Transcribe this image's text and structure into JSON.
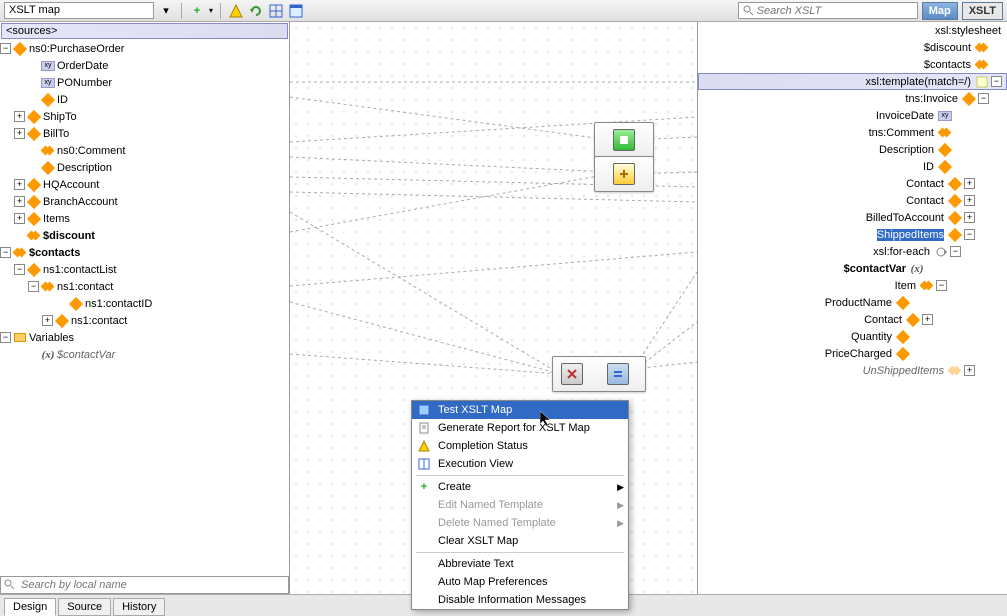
{
  "toolbar": {
    "title": "XSLT map",
    "search_placeholder": "Search XSLT",
    "map_btn": "Map",
    "xslt_btn": "XSLT"
  },
  "filter": {
    "placeholder": "Search by local name"
  },
  "bottom_tabs": {
    "t0": "Design",
    "t1": "Source",
    "t2": "History"
  },
  "source_tree": {
    "header": "<sources>",
    "n0": "ns0:PurchaseOrder",
    "n1": "OrderDate",
    "n2": "PONumber",
    "n3": "ID",
    "n4": "ShipTo",
    "n5": "BillTo",
    "n6": "ns0:Comment",
    "n7": "Description",
    "n8": "HQAccount",
    "n9": "BranchAccount",
    "n10": "Items",
    "n11": "$discount",
    "n12": "$contacts",
    "n13": "ns1:contactList",
    "n14": "ns1:contact",
    "n15": "ns1:contactID",
    "n16": "ns1:contact",
    "n17": "Variables",
    "n18": "$contactVar"
  },
  "target_tree": {
    "n0": "xsl:stylesheet",
    "n1": "$discount",
    "n2": "$contacts",
    "n3": "xsl:template(match=/)",
    "n4": "tns:Invoice",
    "n5": "InvoiceDate",
    "n6": "tns:Comment",
    "n7": "Description",
    "n8": "ID",
    "n9": "Contact",
    "n10": "Contact",
    "n11": "BilledToAccount",
    "n12": "ShippedItems",
    "n13": "xsl:for-each",
    "n14": "$contactVar",
    "n15": "Item",
    "n16": "ProductName",
    "n17": "Contact",
    "n18": "Quantity",
    "n19": "PriceCharged",
    "n20": "UnShippedItems"
  },
  "context_menu": {
    "m0": "Test XSLT Map",
    "m1": "Generate Report for XSLT Map",
    "m2": "Completion Status",
    "m3": "Execution View",
    "m4": "Create",
    "m5": "Edit Named Template",
    "m6": "Delete Named Template",
    "m7": "Clear XSLT Map",
    "m8": "Abbreviate Text",
    "m9": "Auto Map Preferences",
    "m10": "Disable Information Messages"
  }
}
